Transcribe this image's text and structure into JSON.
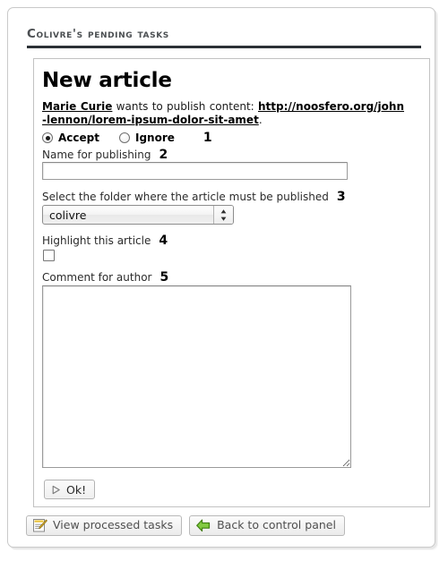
{
  "section": {
    "header_title": "Colivre's pending tasks"
  },
  "task": {
    "title": "New article",
    "description": {
      "author": "Marie Curie",
      "middle_text": " wants to publish content: ",
      "url": "http://noosfero.org/john-lennon/lorem-ipsum-dolor-sit-amet",
      "trailing": "."
    },
    "decision": {
      "step": "1",
      "options": [
        {
          "label": "Accept",
          "selected": true
        },
        {
          "label": "Ignore",
          "selected": false
        }
      ]
    },
    "name_field": {
      "step": "2",
      "label": "Name for publishing",
      "value": "",
      "placeholder": ""
    },
    "folder_field": {
      "step": "3",
      "label": "Select the folder where the article must be published",
      "selected": "colivre",
      "options": [
        "colivre"
      ]
    },
    "highlight_field": {
      "step": "4",
      "label": "Highlight this article",
      "checked": false
    },
    "comment_field": {
      "step": "5",
      "label": "Comment for author",
      "value": "",
      "placeholder": ""
    },
    "submit_button": {
      "label": "Ok!",
      "icon": "play-triangle-icon"
    }
  },
  "bottom_actions": [
    {
      "label": "View processed tasks",
      "icon": "edit-note-icon"
    },
    {
      "label": "Back to control panel",
      "icon": "green-left-arrow-icon"
    }
  ],
  "colors": {
    "header_rule": "#2b3136",
    "header_text": "#4b4f52",
    "panel_border": "#c2c2c2",
    "green_arrow": "#5caa18"
  }
}
